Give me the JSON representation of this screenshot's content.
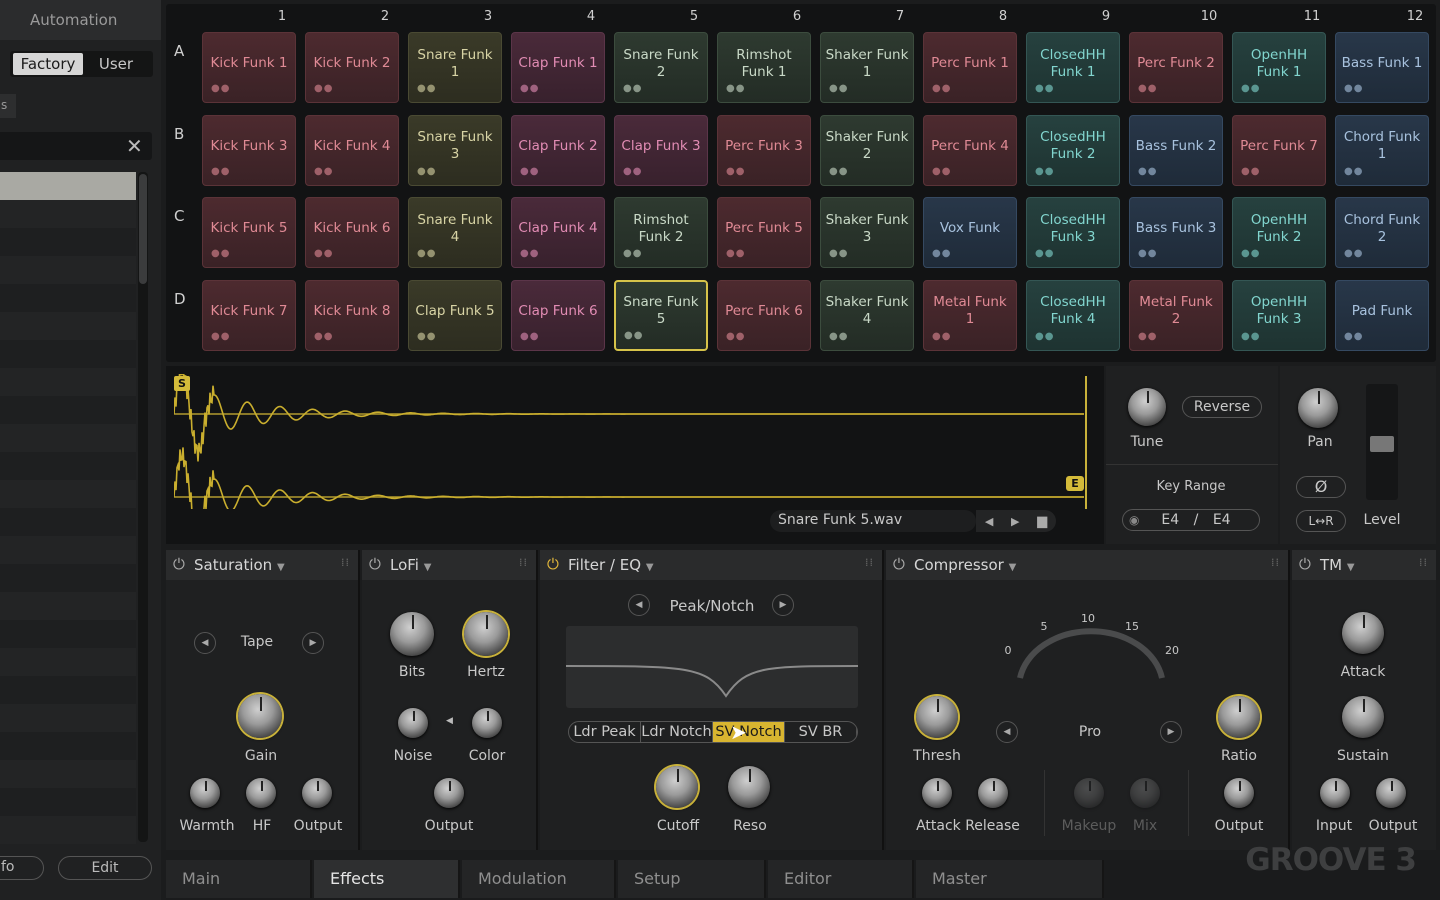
{
  "browser": {
    "title": "Automation",
    "tabs": {
      "factory": "Factory",
      "user": "User"
    },
    "left_label": "s",
    "footer": {
      "info": "fo",
      "edit": "Edit"
    }
  },
  "pads": {
    "columns": [
      "1",
      "2",
      "3",
      "4",
      "5",
      "6",
      "7",
      "8",
      "9",
      "10",
      "11",
      "12"
    ],
    "rows": [
      {
        "letter": "A",
        "pads": [
          "Kick Funk 1",
          "Kick Funk 2",
          "Snare Funk 1",
          "Clap Funk 1",
          "Snare Funk 2",
          "Rimshot Funk 1",
          "Shaker Funk 1",
          "Perc Funk 1",
          "ClosedHH Funk 1",
          "Perc Funk 2",
          "OpenHH Funk 1",
          "Bass Funk 1"
        ]
      },
      {
        "letter": "B",
        "pads": [
          "Kick Funk 3",
          "Kick Funk 4",
          "Snare Funk 3",
          "Clap Funk 2",
          "Clap Funk 3",
          "Perc Funk 3",
          "Shaker Funk 2",
          "Perc Funk 4",
          "ClosedHH Funk 2",
          "Bass Funk 2",
          "Perc Funk 7",
          "Chord Funk 1"
        ]
      },
      {
        "letter": "C",
        "pads": [
          "Kick Funk 5",
          "Kick Funk 6",
          "Snare Funk 4",
          "Clap Funk 4",
          "Rimshot Funk 2",
          "Perc Funk 5",
          "Shaker Funk 3",
          "Vox Funk",
          "ClosedHH Funk 3",
          "Bass Funk 3",
          "OpenHH Funk 2",
          "Chord Funk 2"
        ]
      },
      {
        "letter": "D",
        "pads": [
          "Kick Funk 7",
          "Kick Funk 8",
          "Clap Funk 5",
          "Clap Funk 6",
          "Snare Funk 5",
          "Perc Funk 6",
          "Shaker Funk 4",
          "Metal Funk 1",
          "ClosedHH Funk 4",
          "Metal Funk 2",
          "OpenHH Funk 3",
          "Pad Funk"
        ]
      }
    ],
    "colors": [
      [
        "red",
        "red",
        "yellow",
        "pink",
        "green",
        "green",
        "green",
        "red",
        "teal",
        "red",
        "teal",
        "blue"
      ],
      [
        "red",
        "red",
        "yellow",
        "pink",
        "pink",
        "red",
        "green",
        "red",
        "teal",
        "blue",
        "red",
        "blue"
      ],
      [
        "red",
        "red",
        "yellow",
        "pink",
        "green",
        "red",
        "green",
        "blue",
        "teal",
        "blue",
        "teal",
        "blue"
      ],
      [
        "red",
        "red",
        "yellow",
        "pink",
        "green",
        "red",
        "green",
        "red",
        "teal",
        "red",
        "teal",
        "blue"
      ]
    ],
    "selected": "Snare Funk 5"
  },
  "sample": {
    "start_marker": "S",
    "end_marker": "E",
    "file_name": "Snare Funk 5.wav",
    "nav_prev": "◀",
    "nav_next": "▶"
  },
  "voice": {
    "tune": "Tune",
    "reverse": "Reverse",
    "key_range_label": "Key Range",
    "key_low": "E4",
    "key_sep": "/",
    "key_high": "E4",
    "pan": "Pan",
    "phase": "Ø",
    "lr": "L↔R",
    "level": "Level"
  },
  "effects": {
    "saturation": {
      "title": "Saturation",
      "mode": "Tape",
      "gain": "Gain",
      "warmth": "Warmth",
      "hf": "HF",
      "output": "Output"
    },
    "lofi": {
      "title": "LoFi",
      "bits": "Bits",
      "hertz": "Hertz",
      "noise": "Noise",
      "color": "Color",
      "output": "Output"
    },
    "filter": {
      "title": "Filter / EQ",
      "mode": "Peak/Notch",
      "types": [
        "Ldr Peak",
        "Ldr Notch",
        "SV Notch",
        "SV BR"
      ],
      "active_type": "SV Notch",
      "cutoff": "Cutoff",
      "reso": "Reso"
    },
    "compressor": {
      "title": "Compressor",
      "scale": [
        "0",
        "5",
        "10",
        "15",
        "20"
      ],
      "thresh": "Thresh",
      "mode": "Pro",
      "ratio": "Ratio",
      "attack_release": "Attack Release",
      "makeup": "Makeup",
      "mix": "Mix",
      "output": "Output"
    },
    "tm": {
      "title": "TM",
      "attack": "Attack",
      "sustain": "Sustain",
      "input": "Input",
      "output": "Output"
    }
  },
  "bottom_tabs": [
    "Main",
    "Effects",
    "Modulation",
    "Setup",
    "Editor",
    "Master"
  ],
  "active_tab": "Effects",
  "logo": "GROOVE 3"
}
